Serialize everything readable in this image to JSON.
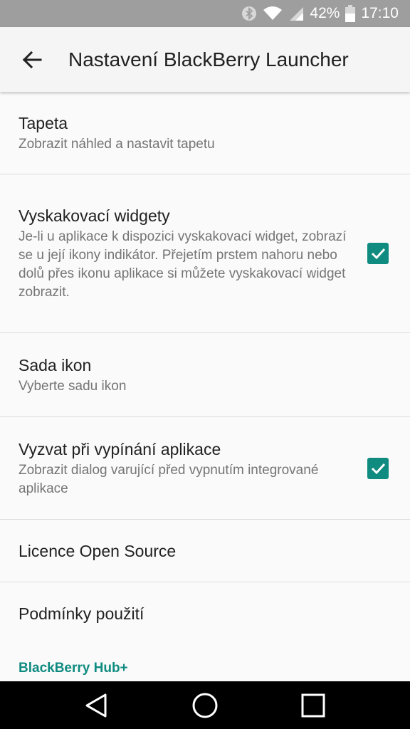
{
  "status_bar": {
    "battery_percent": "42%",
    "time": "17:10",
    "icons": [
      "bluetooth-icon",
      "wifi-icon",
      "signal-icon",
      "battery-icon"
    ]
  },
  "app_bar": {
    "back_icon": "arrow-back-icon",
    "title": "Nastavení BlackBerry Launcher"
  },
  "preferences": [
    {
      "title": "Tapeta",
      "summary": "Zobrazit náhled a nastavit tapetu"
    },
    {
      "title": "Vyskakovací widgety",
      "summary": "Je-li u aplikace k dispozici vyskakovací widget, zobrazí se u její ikony indikátor. Přejetím prstem nahoru nebo dolů přes ikonu aplikace si můžete vyskakovací widget zobrazit.",
      "checked": true
    },
    {
      "title": "Sada ikon",
      "summary": "Vyberte sadu ikon"
    },
    {
      "title": "Vyzvat při vypínání aplikace",
      "summary": "Zobrazit dialog varující před vypnutím integrované aplikace",
      "checked": true
    },
    {
      "title": "Licence Open Source"
    },
    {
      "title": "Podmínky použití"
    }
  ],
  "category_header": "BlackBerry Hub+",
  "nav_bar": {
    "icons": [
      "back-triangle-icon",
      "home-circle-icon",
      "recents-square-icon"
    ]
  },
  "colors": {
    "accent": "#0f8b80",
    "status_bar": "#9e9e9e",
    "app_bar": "#f5f5f5",
    "background": "#fafafa"
  }
}
